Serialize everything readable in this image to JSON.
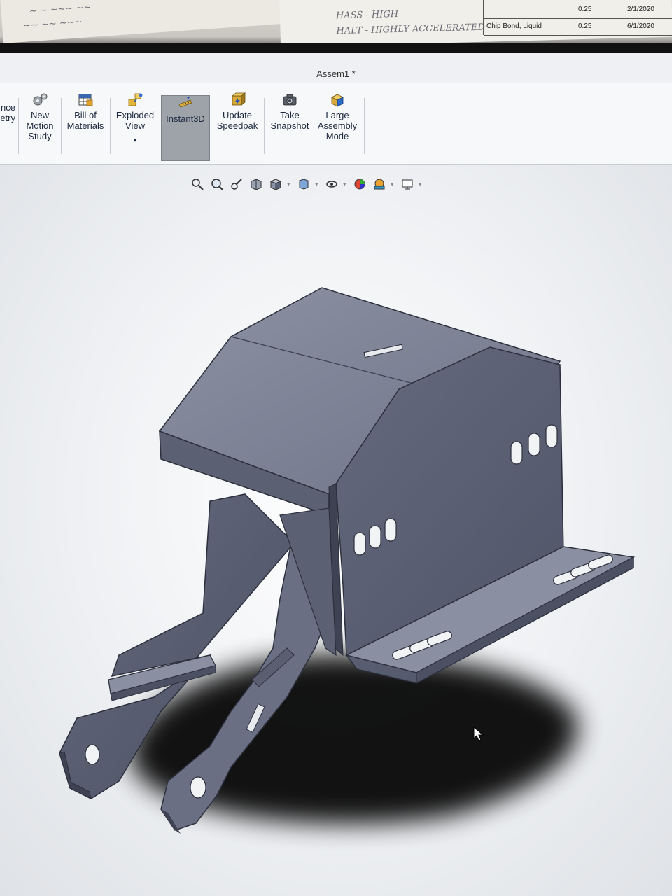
{
  "window": {
    "title": "Assem1 *"
  },
  "ribbon": {
    "partial_label_line1": "nce",
    "partial_label_line2": "etry",
    "buttons": [
      {
        "line1": "New",
        "line2": "Motion",
        "line3": "Study",
        "icon": "motion-study-icon"
      },
      {
        "line1": "Bill of",
        "line2": "Materials",
        "icon": "bill-of-materials-icon"
      },
      {
        "line1": "Exploded",
        "line2": "View",
        "icon": "exploded-view-icon"
      },
      {
        "line1": "Instant3D",
        "icon": "instant3d-icon",
        "active": true
      },
      {
        "line1": "Update",
        "line2": "Speedpak",
        "icon": "speedpak-icon"
      },
      {
        "line1": "Take",
        "line2": "Snapshot",
        "icon": "camera-icon"
      },
      {
        "line1": "Large",
        "line2": "Assembly",
        "line3": "Mode",
        "icon": "large-assembly-icon"
      }
    ]
  },
  "heads_up_toolbar": [
    "zoom-to-fit-icon",
    "zoom-to-area-icon",
    "previous-view-icon",
    "section-view-icon",
    "view-orientation-icon",
    "display-style-icon",
    "hide-show-icon",
    "edit-appearance-icon",
    "apply-scene-icon",
    "view-settings-icon"
  ],
  "paper_note": {
    "line1": "HASS - HIGH",
    "line2": "HALT - HIGHLY ACCELERATED"
  },
  "paper_table": [
    {
      "item": "",
      "value": "0.25",
      "date": "2/1/2020"
    },
    {
      "item": "Chip Bond, Liquid",
      "value": "0.25",
      "date": "6/1/2020"
    }
  ],
  "colors": {
    "part_top": "#7d8295",
    "part_side": "#5c6073",
    "part_dark": "#43475a",
    "active_button": "#9ea3aa"
  }
}
